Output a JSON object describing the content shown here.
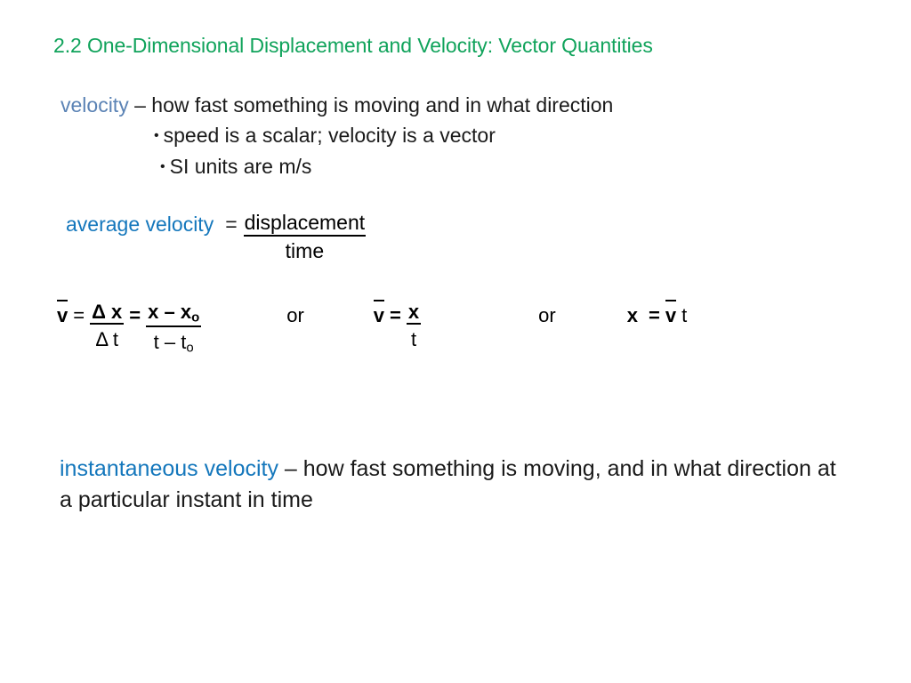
{
  "slide": {
    "title": "2.2 One-Dimensional Displacement and Velocity: Vector Quantities",
    "title_color": "#10A35B",
    "background_color": "#ffffff"
  },
  "definition": {
    "term": "velocity",
    "term_color": "#5B83B5",
    "dash": " – ",
    "description": "how fast something is moving and in what direction",
    "bullets": [
      {
        "marker": "•",
        "text": "speed is a scalar; velocity is a vector"
      },
      {
        "marker": "•",
        "text": "SI units are m/s"
      }
    ]
  },
  "average_velocity": {
    "term": "average velocity",
    "term_color": "#1477BC",
    "equals": "=",
    "numerator": "displacement",
    "denominator": "time"
  },
  "formulas": {
    "separator": "or",
    "first": {
      "lhs": "v",
      "lhs_overbar": true,
      "eq1": "=",
      "frac1_num": "Δ x",
      "frac1_den": "Δ t",
      "eq2": "=",
      "frac2_num_a": "x – x",
      "frac2_num_sub": "o",
      "frac2_den_a": "t – t",
      "frac2_den_sub": "o"
    },
    "second": {
      "lhs": "v",
      "lhs_overbar": true,
      "eq": "=",
      "num": "x",
      "den": "t"
    },
    "third": {
      "lhs": "x",
      "eq": "=",
      "rhs_bar": "v",
      "rhs_tail": "t"
    }
  },
  "instantaneous": {
    "term": "instantaneous velocity",
    "term_color": "#1477BC",
    "dash": " – ",
    "description": "how fast something is moving, and in what direction at a particular instant in time"
  }
}
